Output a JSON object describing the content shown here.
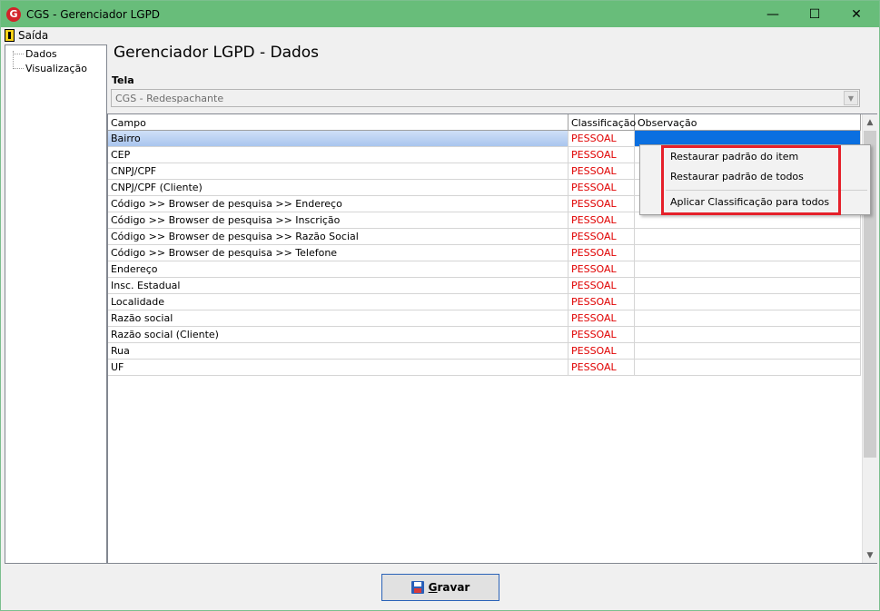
{
  "window": {
    "title": "CGS - Gerenciador LGPD",
    "app_icon_letter": "G",
    "minimize_glyph": "—",
    "maximize_glyph": "☐",
    "close_glyph": "✕",
    "titlebar_color": "#68bd7a"
  },
  "menu": {
    "exit_label": "Saída"
  },
  "tree": {
    "items": [
      "Dados",
      "Visualização"
    ]
  },
  "page": {
    "title": "Gerenciador LGPD - Dados",
    "tela_label": "Tela",
    "tela_value": "CGS - Redespachante",
    "combo_arrow": "▼"
  },
  "grid": {
    "columns": [
      "Campo",
      "Classificação",
      "Observação"
    ],
    "rows": [
      {
        "campo": "Bairro",
        "classificacao": "PESSOAL",
        "observacao": ""
      },
      {
        "campo": "CEP",
        "classificacao": "PESSOAL",
        "observacao": ""
      },
      {
        "campo": "CNPJ/CPF",
        "classificacao": "PESSOAL",
        "observacao": ""
      },
      {
        "campo": "CNPJ/CPF (Cliente)",
        "classificacao": "PESSOAL",
        "observacao": ""
      },
      {
        "campo": "Código >> Browser de pesquisa >> Endereço",
        "classificacao": "PESSOAL",
        "observacao": ""
      },
      {
        "campo": "Código >> Browser de pesquisa >> Inscrição",
        "classificacao": "PESSOAL",
        "observacao": ""
      },
      {
        "campo": "Código >> Browser de pesquisa >> Razão Social",
        "classificacao": "PESSOAL",
        "observacao": ""
      },
      {
        "campo": "Código >> Browser de pesquisa >> Telefone",
        "classificacao": "PESSOAL",
        "observacao": ""
      },
      {
        "campo": "Endereço",
        "classificacao": "PESSOAL",
        "observacao": ""
      },
      {
        "campo": "Insc. Estadual",
        "classificacao": "PESSOAL",
        "observacao": ""
      },
      {
        "campo": "Localidade",
        "classificacao": "PESSOAL",
        "observacao": ""
      },
      {
        "campo": "Razão social",
        "classificacao": "PESSOAL",
        "observacao": ""
      },
      {
        "campo": "Razão social (Cliente)",
        "classificacao": "PESSOAL",
        "observacao": ""
      },
      {
        "campo": "Rua",
        "classificacao": "PESSOAL",
        "observacao": ""
      },
      {
        "campo": "UF",
        "classificacao": "PESSOAL",
        "observacao": ""
      }
    ],
    "selected_index": 0,
    "classification_color": "#e00000",
    "scroll_up": "▲",
    "scroll_down": "▼"
  },
  "context_menu": {
    "items": [
      "Restaurar padrão do item",
      "Restaurar padrão de todos",
      "Aplicar Classificação para todos"
    ],
    "highlight_color": "#e5202a"
  },
  "footer": {
    "save_label_first": "G",
    "save_label_rest": "ravar"
  }
}
